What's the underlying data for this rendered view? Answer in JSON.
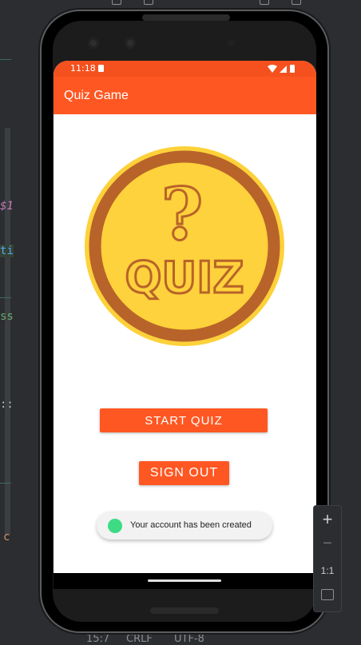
{
  "ide": {
    "code_fragments": [
      "$1",
      "ti",
      "ss",
      "::",
      "c"
    ],
    "bottom_status": [
      "15:7",
      "CRLF",
      "UTF-8"
    ]
  },
  "device": {
    "status_bar": {
      "time": "11:18"
    },
    "app_bar": {
      "title": "Quiz Game"
    },
    "logo": {
      "symbol": "?",
      "text": "QUIZ"
    },
    "buttons": {
      "start_quiz": "START QUIZ",
      "sign_out": "SIGN OUT"
    },
    "toast": {
      "message": "Your account has been created"
    }
  },
  "emulator_panel": {
    "zoom_in": "+",
    "zoom_out": "−",
    "ratio": "1:1"
  },
  "colors": {
    "status_bar": "#f4511e",
    "app_bar": "#ff5722",
    "button": "#ff5722",
    "logo_fill": "#fdd13a",
    "logo_ring": "#b8632a"
  }
}
